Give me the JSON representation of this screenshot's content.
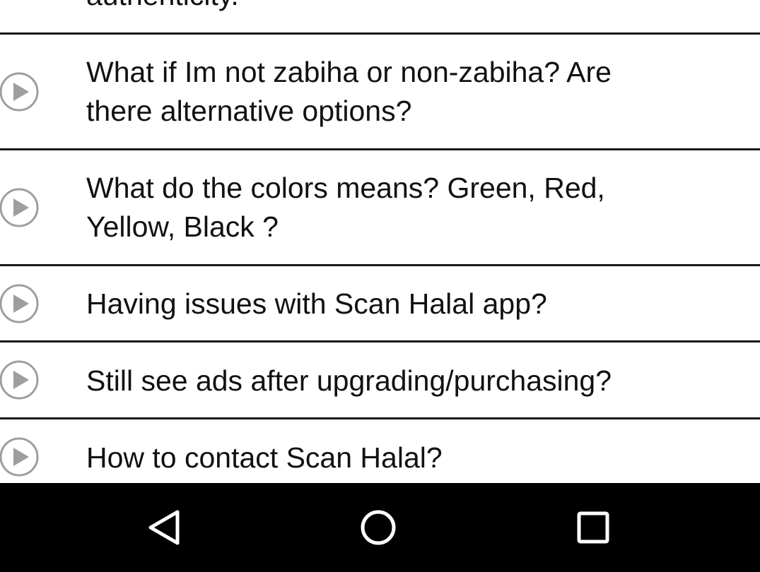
{
  "faq": {
    "partial_item": {
      "label": "authenticity."
    },
    "items": [
      {
        "label": "What if Im not zabiha or non-zabiha? Are\nthere alternative options?"
      },
      {
        "label": "What do the colors means? Green, Red,\nYellow, Black ?"
      },
      {
        "label": "Having issues with Scan Halal app?"
      },
      {
        "label": "Still see ads after upgrading/purchasing?"
      },
      {
        "label": "How to contact Scan Halal?"
      }
    ],
    "icon": "play-circle-icon"
  },
  "navbar": {
    "buttons": [
      "back-icon",
      "home-icon",
      "recents-icon"
    ]
  },
  "colors": {
    "text": "#111111",
    "divider": "#1a1a1a",
    "icon_gray": "#9e9e9e",
    "navbar_bg": "#000000",
    "nav_icon": "#ffffff"
  }
}
